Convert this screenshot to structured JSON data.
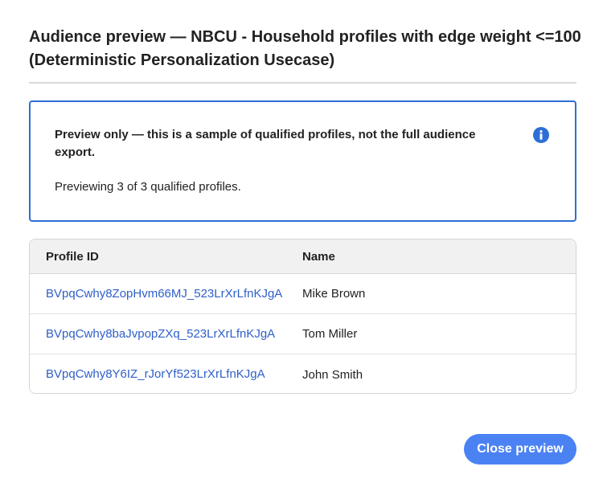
{
  "dialog": {
    "title": "Audience preview — NBCU - Household profiles with edge weight <=100 (Deterministic Personalization Usecase)"
  },
  "notice": {
    "heading": "Preview only — this is a sample of qualified profiles, not the full audience export.",
    "body": "Previewing 3 of 3 qualified profiles.",
    "icon": "info-icon",
    "accent_color": "#2d6fd6"
  },
  "table": {
    "headers": {
      "profile_id": "Profile ID",
      "name": "Name"
    },
    "rows": [
      {
        "profile_id": "BVpqCwhy8ZopHvm66MJ_523LrXrLfnKJgA",
        "name": "Mike Brown"
      },
      {
        "profile_id": "BVpqCwhy8baJvpopZXq_523LrXrLfnKJgA",
        "name": "Tom Miller"
      },
      {
        "profile_id": "BVpqCwhy8Y6IZ_rJorYf523LrXrLfnKJgA",
        "name": "John Smith"
      }
    ],
    "link_color": "#2f5fc8"
  },
  "footer": {
    "close_label": "Close preview",
    "button_color": "#4a82f4"
  }
}
